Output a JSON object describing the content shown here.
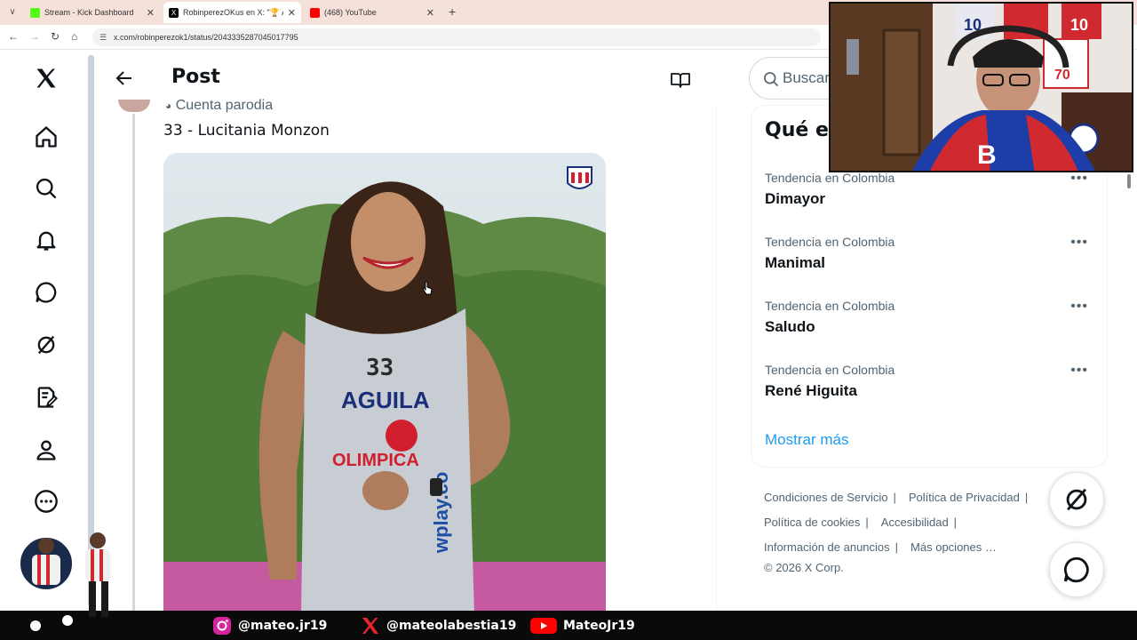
{
  "browser": {
    "tabs": [
      {
        "title": "Stream - Kick Dashboard",
        "favicon_color": "#53fc18"
      },
      {
        "title": "RobinperezOKus en X: \"🏆 Abrazo",
        "favicon_color": "#000000"
      },
      {
        "title": "(468) YouTube",
        "favicon_color": "#ff0000"
      }
    ],
    "url": "x.com/robinperezok1/status/2043335287045017795"
  },
  "nav": {
    "items": [
      "x-logo",
      "home-icon",
      "search-icon",
      "notifications-icon",
      "messages-icon",
      "grok-icon",
      "drafts-icon",
      "profile-icon",
      "more-icon"
    ]
  },
  "post": {
    "header_title": "Post",
    "parody_label": "Cuenta parodia",
    "text": "33 - Lucitania Monzon",
    "image": {
      "jersey_number": "33",
      "sponsor_top": "AGUILA",
      "sponsor_mid": "OLIMPICA",
      "sponsor_side": "wplay.co"
    }
  },
  "sidebar": {
    "search_placeholder": "Buscar",
    "trends_title": "Qué está pasando",
    "trends": [
      {
        "context": "Tendencia en Colombia",
        "name": "Dimayor"
      },
      {
        "context": "Tendencia en Colombia",
        "name": "Manimal"
      },
      {
        "context": "Tendencia en Colombia",
        "name": "Saludo"
      },
      {
        "context": "Tendencia en Colombia",
        "name": "René Higuita"
      }
    ],
    "show_more": "Mostrar más",
    "more_glyph": "•••",
    "footer": {
      "terms": "Condiciones de Servicio",
      "privacy": "Política de Privacidad",
      "cookies": "Política de cookies",
      "accessibility": "Accesibilidad",
      "ads_info": "Información de anuncios",
      "more_options": "Más opciones …",
      "copyright": "© 2026 X Corp."
    }
  },
  "stream_banner": {
    "instagram": "@mateo.jr19",
    "x": "@mateolabestia19",
    "youtube": "MateoJr19"
  },
  "colors": {
    "accent": "#1d9bf0",
    "text_primary": "#0f1419",
    "text_secondary": "#536471"
  }
}
